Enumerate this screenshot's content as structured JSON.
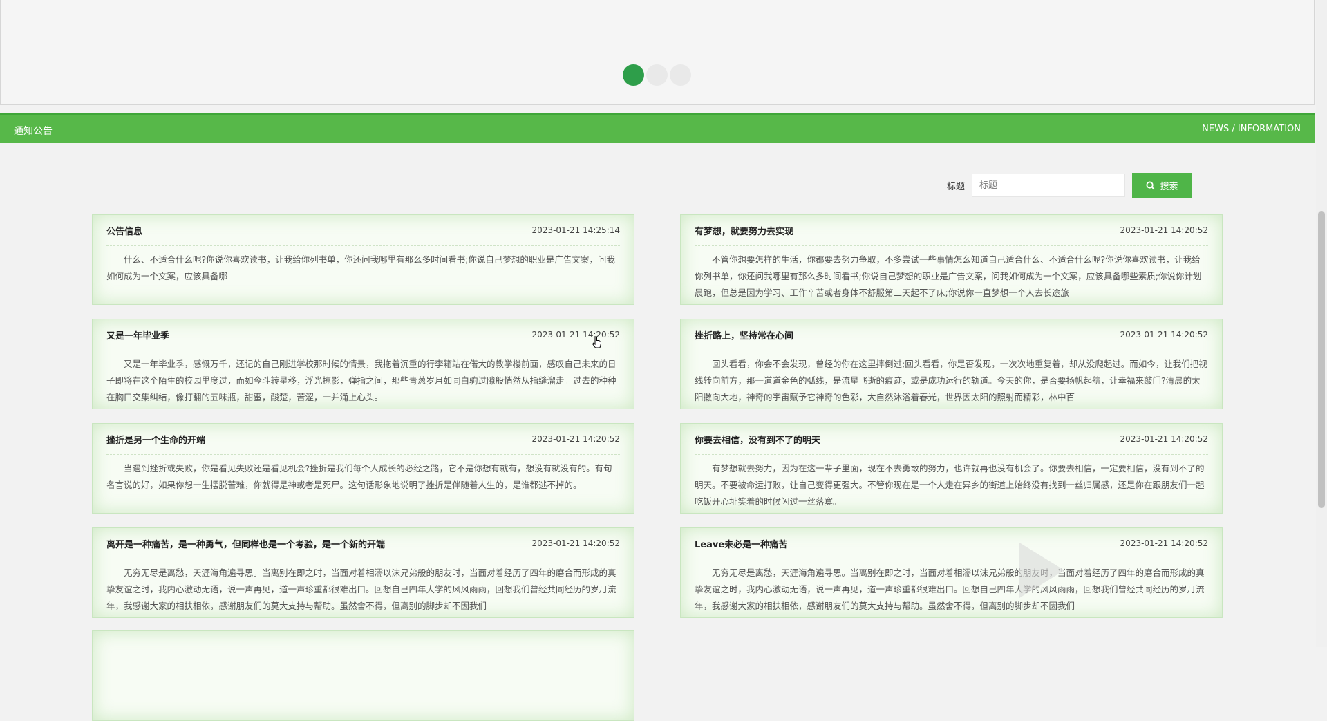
{
  "carousel": {
    "dots": 3,
    "active_index": 0
  },
  "news_bar": {
    "left": "通知公告",
    "right": "NEWS / INFORMATION"
  },
  "search": {
    "label": "标题",
    "placeholder": "标题",
    "button_label": "搜索"
  },
  "cards": [
    {
      "title": "公告信息",
      "time": "2023-01-21 14:25:14",
      "body": "什么、不适合什么呢?你说你喜欢读书，让我给你列书单，你还问我哪里有那么多时间看书;你说自己梦想的职业是广告文案，问我如何成为一个文案，应该具备哪"
    },
    {
      "title": "有梦想，就要努力去实现",
      "time": "2023-01-21 14:20:52",
      "body": "不管你想要怎样的生活，你都要去努力争取，不多尝试一些事情怎么知道自己适合什么、不适合什么呢?你说你喜欢读书，让我给你列书单，你还问我哪里有那么多时间看书;你说自己梦想的职业是广告文案，问我如何成为一个文案，应该具备哪些素质;你说你计划晨跑，但总是因为学习、工作辛苦或者身体不舒服第二天起不了床;你说你一直梦想一个人去长途旅"
    },
    {
      "title": "又是一年毕业季",
      "time": "2023-01-21 14:20:52",
      "body": "又是一年毕业季，感慨万千，还记的自己刚进学校那时候的情景，我拖着沉重的行李箱站在偌大的教学楼前面，感叹自己未来的日子即将在这个陌生的校园里度过，而如今斗转星移，浮光掠影，弹指之间，那些青葱岁月如同白驹过隙般悄然从指缝溜走。过去的种种在胸口交集纠结，像打翻的五味瓶，甜蜜，酸楚，苦涩，一并涌上心头。"
    },
    {
      "title": "挫折路上，坚持常在心间",
      "time": "2023-01-21 14:20:52",
      "body": "回头看看，你会不会发现，曾经的你在这里摔倒过;回头看看，你是否发现，一次次地重复着，却从没爬起过。而如今，让我们把视线转向前方，那一道道金色的弧线，是流星飞逝的痕迹，或是成功运行的轨道。今天的你，是否要扬帆起航，让幸福来敲门?清晨的太阳撒向大地，神奇的宇宙赋予它神奇的色彩，大自然沐浴着春光，世界因太阳的照射而精彩，林中百"
    },
    {
      "title": "挫折是另一个生命的开端",
      "time": "2023-01-21 14:20:52",
      "body": "当遇到挫折或失败，你是看见失败还是看见机会?挫折是我们每个人成长的必经之路，它不是你想有就有，想没有就没有的。有句名言说的好，如果你想一生摆脱苦难，你就得是神或者是死尸。这句话形象地说明了挫折是伴随着人生的，是谁都逃不掉的。"
    },
    {
      "title": "你要去相信，没有到不了的明天",
      "time": "2023-01-21 14:20:52",
      "body": "有梦想就去努力，因为在这一辈子里面，现在不去勇敢的努力，也许就再也没有机会了。你要去相信，一定要相信，没有到不了的明天。不要被命运打败，让自己变得更强大。不管你现在是一个人走在异乡的街道上始终没有找到一丝归属感，还是你在跟朋友们一起吃饭开心址笑着的时候闪过一丝落寞。"
    },
    {
      "title": "离开是一种痛苦，是一种勇气，但同样也是一个考验，是一个新的开端",
      "time": "2023-01-21 14:20:52",
      "body": "无穷无尽是离愁，天涯海角遍寻思。当离别在即之时，当面对着相濡以沫兄弟般的朋友时，当面对着经历了四年的磨合而形成的真挚友谊之时，我内心激动无语，说一声再见，道一声珍重都很难出口。回想自己四年大学的风风雨雨，回想我们曾经共同经历的岁月流年，我感谢大家的相扶相依，感谢朋友们的莫大支持与帮助。虽然舍不得，但离别的脚步却不因我们"
    },
    {
      "title": "Leave未必是一种痛苦",
      "time": "2023-01-21 14:20:52",
      "body": "无穷无尽是离愁，天涯海角遍寻思。当离别在即之时，当面对着相濡以沫兄弟般的朋友时，当面对着经历了四年的磨合而形成的真挚友谊之时，我内心激动无语，说一声再见，道一声珍重都很难出口。回想自己四年大学的风风雨雨，回想我们曾经共同经历的岁月流年，我感谢大家的相扶相依，感谢朋友们的莫大支持与帮助。虽然舍不得，但离别的脚步却不因我们"
    },
    {
      "title": "",
      "time": "",
      "body": ""
    }
  ]
}
